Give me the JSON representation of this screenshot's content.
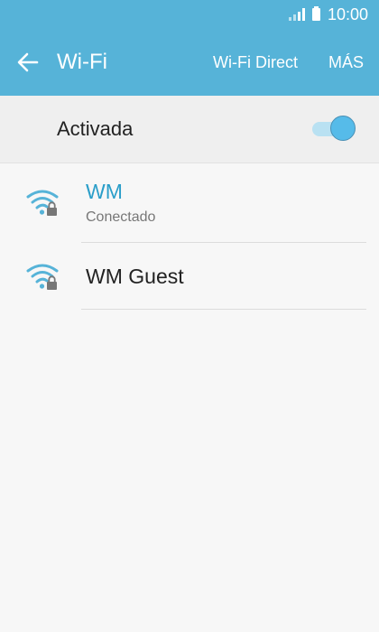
{
  "status_bar": {
    "time": "10:00",
    "icons": [
      "signal-icon",
      "battery-icon"
    ]
  },
  "app_bar": {
    "title": "Wi-Fi",
    "back_icon": "arrow-left-icon",
    "actions": {
      "wifi_direct": "Wi-Fi Direct",
      "more": "MÁS"
    }
  },
  "master_switch": {
    "label": "Activada",
    "state": "on"
  },
  "networks": [
    {
      "name": "WM",
      "status": "Conectado",
      "icon": "wifi-lock-icon",
      "connected": true
    },
    {
      "name": "WM Guest",
      "status": "",
      "icon": "wifi-lock-icon",
      "connected": false
    }
  ],
  "colors": {
    "primary": "#56b3d8",
    "accent": "#2a9ec9",
    "background": "#f7f7f7"
  }
}
